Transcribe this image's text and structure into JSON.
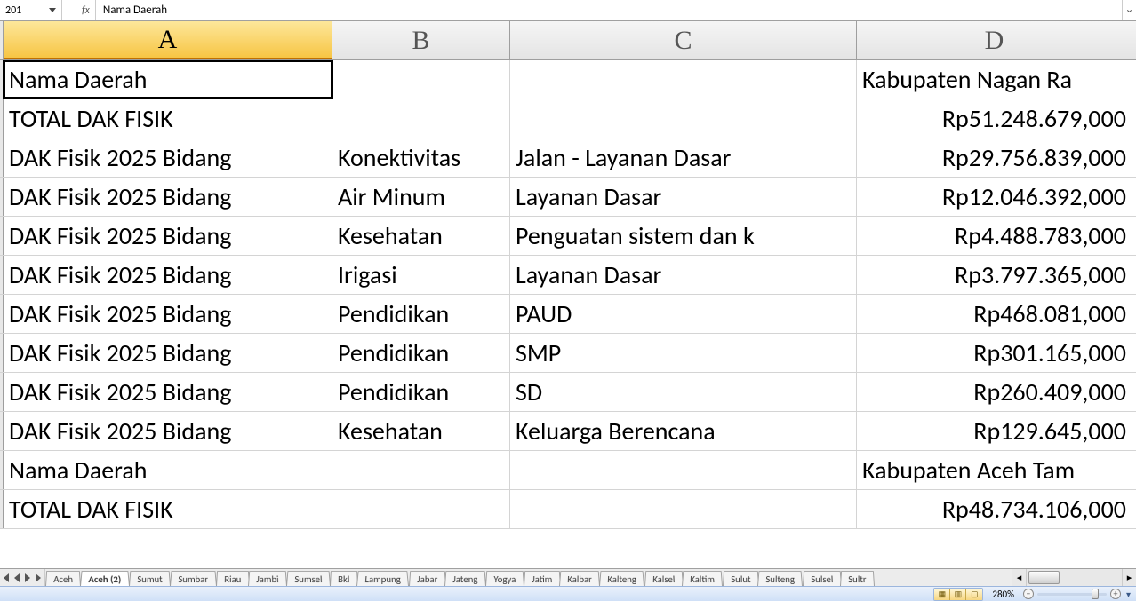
{
  "formula_bar": {
    "cell_ref": "201",
    "fx_label": "fx",
    "content": "Nama Daerah"
  },
  "columns": [
    "A",
    "B",
    "C",
    "D"
  ],
  "selected_column_index": 0,
  "active_cell": {
    "row": 0,
    "col": 0
  },
  "rows": [
    {
      "a": "Nama Daerah",
      "b": "",
      "c": "",
      "d": "Kabupaten Nagan Ra",
      "d_right": false
    },
    {
      "a": "TOTAL DAK FISIK",
      "b": "",
      "c": "",
      "d": "Rp51.248.679,000",
      "d_right": true
    },
    {
      "a": "DAK Fisik 2025 Bidang",
      "b": "Konektivitas",
      "c": "Jalan - Layanan Dasar",
      "d": "Rp29.756.839,000",
      "d_right": true
    },
    {
      "a": "DAK Fisik 2025 Bidang",
      "b": "Air Minum",
      "c": "Layanan Dasar",
      "d": "Rp12.046.392,000",
      "d_right": true
    },
    {
      "a": "DAK Fisik 2025 Bidang",
      "b": "Kesehatan",
      "c": "Penguatan sistem dan k",
      "d": "Rp4.488.783,000",
      "d_right": true
    },
    {
      "a": "DAK Fisik 2025 Bidang",
      "b": "Irigasi",
      "c": "Layanan Dasar",
      "d": "Rp3.797.365,000",
      "d_right": true
    },
    {
      "a": "DAK Fisik 2025 Bidang",
      "b": "Pendidikan",
      "c": "PAUD",
      "d": "Rp468.081,000",
      "d_right": true
    },
    {
      "a": "DAK Fisik 2025 Bidang",
      "b": "Pendidikan",
      "c": "SMP",
      "d": "Rp301.165,000",
      "d_right": true
    },
    {
      "a": "DAK Fisik 2025 Bidang",
      "b": "Pendidikan",
      "c": "SD",
      "d": "Rp260.409,000",
      "d_right": true
    },
    {
      "a": "DAK Fisik 2025 Bidang",
      "b": "Kesehatan",
      "c": "Keluarga Berencana",
      "d": "Rp129.645,000",
      "d_right": true
    },
    {
      "a": "Nama Daerah",
      "b": "",
      "c": "",
      "d": "Kabupaten Aceh Tam",
      "d_right": false
    },
    {
      "a": "TOTAL DAK FISIK",
      "b": "",
      "c": "",
      "d": "Rp48.734.106,000",
      "d_right": true
    }
  ],
  "sheet_tabs": [
    "Aceh",
    "Aceh (2)",
    "Sumut",
    "Sumbar",
    "Riau",
    "Jambi",
    "Sumsel",
    "Bkl",
    "Lampung",
    "Jabar",
    "Jateng",
    "Yogya",
    "Jatim",
    "Kalbar",
    "Kalteng",
    "Kalsel",
    "Kaltim",
    "Sulut",
    "Sulteng",
    "Sulsel",
    "Sultr"
  ],
  "active_tab_index": 1,
  "status_bar": {
    "zoom_pct": "280%",
    "view_icons": [
      "▦",
      "▥",
      "▢"
    ]
  }
}
